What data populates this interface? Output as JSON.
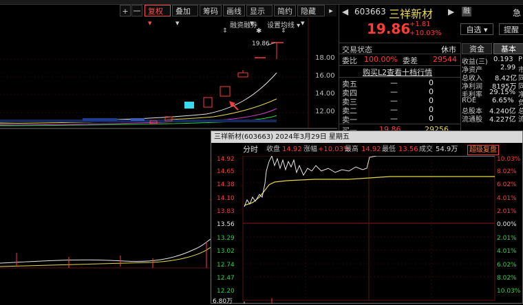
{
  "toolbar": {
    "plus": "+",
    "minus": "一",
    "fuquan": "复权",
    "diejia": "叠加",
    "chouma": "筹码",
    "huaxian": "画线",
    "xianshi": "显示",
    "jianyue": "简约",
    "yincang": "隐藏"
  },
  "kline": {
    "margin_label": "融资融券",
    "settings_label": "设置均线",
    "high_label": "19.86",
    "y_ticks": [
      "18.00",
      "16.00",
      "14.00",
      "12.00"
    ]
  },
  "stock": {
    "code": "603663",
    "name": "三祥新材",
    "price": "19.86",
    "change": "+1.81",
    "change_pct": "+10.03%",
    "rong_badge": "融",
    "watch_btn": "自选",
    "alert_btn": "提醒",
    "right_edge": "急"
  },
  "trade": {
    "status_label": "交易状态",
    "status_value": "休市",
    "weibi_label": "委比",
    "weibi_value": "100.00%",
    "weicha_label": "委差",
    "weicha_value": "29544",
    "l2_label": "购买L2查看十档行情",
    "asks": [
      {
        "label": "卖五",
        "price": "—",
        "vol": "0"
      },
      {
        "label": "卖四",
        "price": "—",
        "vol": "0"
      },
      {
        "label": "卖三",
        "price": "—",
        "vol": "0"
      },
      {
        "label": "卖二",
        "price": "—",
        "vol": "0"
      },
      {
        "label": "卖一",
        "price": "—",
        "vol": "0"
      }
    ],
    "bid1": {
      "label": "买一",
      "price": "19.86",
      "vol": "29256"
    }
  },
  "fund_tabs": {
    "fund": "资金",
    "basic": "基本"
  },
  "fundamentals": [
    {
      "label": "收益(三)",
      "value": "0.193",
      "extra": "PE"
    },
    {
      "label": "净资产",
      "value": "2.99",
      "extra": "市"
    },
    {
      "label": "总收入",
      "value": "8.42亿",
      "extra": "同"
    },
    {
      "label": "净利润",
      "value": "8195万",
      "extra": "同"
    },
    {
      "label": "毛利率",
      "value": "29.15%",
      "extra": "净"
    },
    {
      "label": "ROE",
      "value": "6.65%",
      "extra": "负"
    },
    {
      "label": "总股本",
      "value": "4.240亿",
      "extra": "总"
    },
    {
      "label": "流通股",
      "value": "4.227亿",
      "extra": "流"
    }
  ],
  "popup": {
    "title": "三祥新材(603663)  2024年3月29日  星期五",
    "tab": "分时",
    "close_label": "收盘",
    "close_value": "14.92",
    "chg_label": "涨幅",
    "chg_value": "+10.03%",
    "high_label": "最高",
    "high_value": "14.92",
    "low_label": "最低",
    "low_value": "13.56",
    "amount_label": "成交",
    "amount_value": "54.9万",
    "btn": "超级复盘",
    "left_ticks": [
      "14.92",
      "14.65",
      "14.38",
      "14.10",
      "13.83",
      "13.56",
      "13.29",
      "13.02",
      "12.74",
      "12.47",
      "12.20"
    ],
    "right_ticks": [
      "10.03%",
      "8.02%",
      "6.02%",
      "4.01%",
      "2.01%",
      "0.00%",
      "2.01%",
      "4.01%",
      "6.02%",
      "8.02%",
      "10.03%"
    ],
    "vol_tick": "6.80万"
  }
}
